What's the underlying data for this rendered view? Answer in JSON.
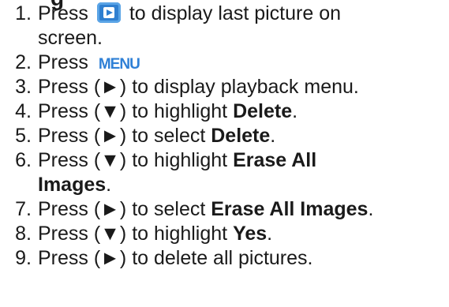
{
  "title_fragment": "g",
  "steps": [
    {
      "num": "1.",
      "a": "Press",
      "icon": "playback-button-icon",
      "b": "to display last picture on",
      "c": "screen."
    },
    {
      "num": "2.",
      "a": "Press",
      "icon": "menu-button-icon",
      "icon_text": "MENU"
    },
    {
      "num": "3.",
      "a": "Press (►) to display playback menu."
    },
    {
      "num": "4.",
      "a": "Press (▼) to highlight ",
      "bold": "Delete",
      "end": "."
    },
    {
      "num": "5.",
      "a": "Press (►) to select ",
      "bold": "Delete",
      "end": "."
    },
    {
      "num": "6.",
      "a": "Press (▼) to highlight ",
      "bold": "Erase All",
      "bold2": "Images",
      "end": "."
    },
    {
      "num": "7.",
      "a": "Press (►) to select ",
      "bold": "Erase All Images",
      "end": "."
    },
    {
      "num": "8.",
      "a": "Press (▼) to highlight ",
      "bold": "Yes",
      "end": "."
    },
    {
      "num": "9.",
      "a": "Press (►) to delete all pictures."
    }
  ]
}
